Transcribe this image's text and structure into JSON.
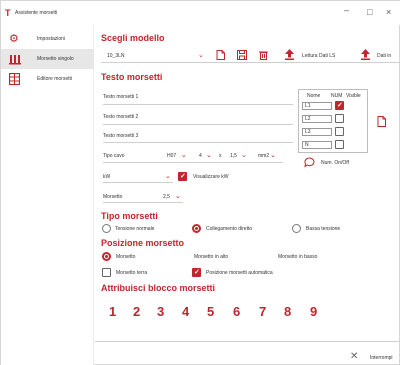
{
  "window": {
    "title": "Assistente morsetti",
    "controls": {
      "minimize": "–",
      "maximize": "□",
      "close": "×"
    }
  },
  "sidebar": {
    "items": [
      {
        "label": "Impostazioni",
        "icon": "gear-icon"
      },
      {
        "label": "Morsetto singolo",
        "icon": "terminal-icon"
      },
      {
        "label": "Editore morsetti",
        "icon": "grid-icon"
      }
    ]
  },
  "model": {
    "heading": "Scegli modello",
    "value": "10_3LN",
    "read_label": "Lettura Dati LS",
    "data_label": "Dati in"
  },
  "texts": {
    "heading": "Testo morsetti",
    "line1": "Testo morsetti 1",
    "line2": "Testo morsetti 2",
    "line3": "Testo morsetti 3",
    "cable_label": "Tipo cavo",
    "cable_value1": "H07",
    "cable_value2": "4",
    "cable_x": "x",
    "cable_value3": "1,5",
    "cable_unit": "mm2",
    "num_onoff": "Num. On/Off",
    "kw_value": "kW",
    "show_kw": "Visualizzare kW",
    "terminal_label": "Morsetto",
    "terminal_value": "2,5"
  },
  "table": {
    "headers": [
      "Nome",
      "NUM",
      "Visible"
    ],
    "rows": [
      {
        "name": "L1",
        "checked": true
      },
      {
        "name": "L2",
        "checked": false
      },
      {
        "name": "L3",
        "checked": false
      },
      {
        "name": "N",
        "checked": false
      }
    ]
  },
  "type": {
    "heading": "Tipo morsetti",
    "options": [
      "Tensione normale",
      "Collegamento diretto",
      "Bassa tensione"
    ],
    "selected": 1
  },
  "position": {
    "heading": "Posizione morsetto",
    "options": [
      "Morsetto",
      "Morsetto in alto",
      "Morsetto in basso"
    ],
    "selected": 0,
    "ground_label": "Morsetto terra",
    "auto_label": "Posizione morsetti automatica",
    "auto_checked": true
  },
  "attributes": {
    "heading": "Attribuisci blocco morsetti",
    "numbers": [
      "1",
      "2",
      "3",
      "4",
      "5",
      "6",
      "7",
      "8",
      "9"
    ]
  },
  "footer": {
    "label": "Interrompi"
  },
  "colors": {
    "accent": "#c0262d",
    "active_bg": "#e7e7e7"
  }
}
